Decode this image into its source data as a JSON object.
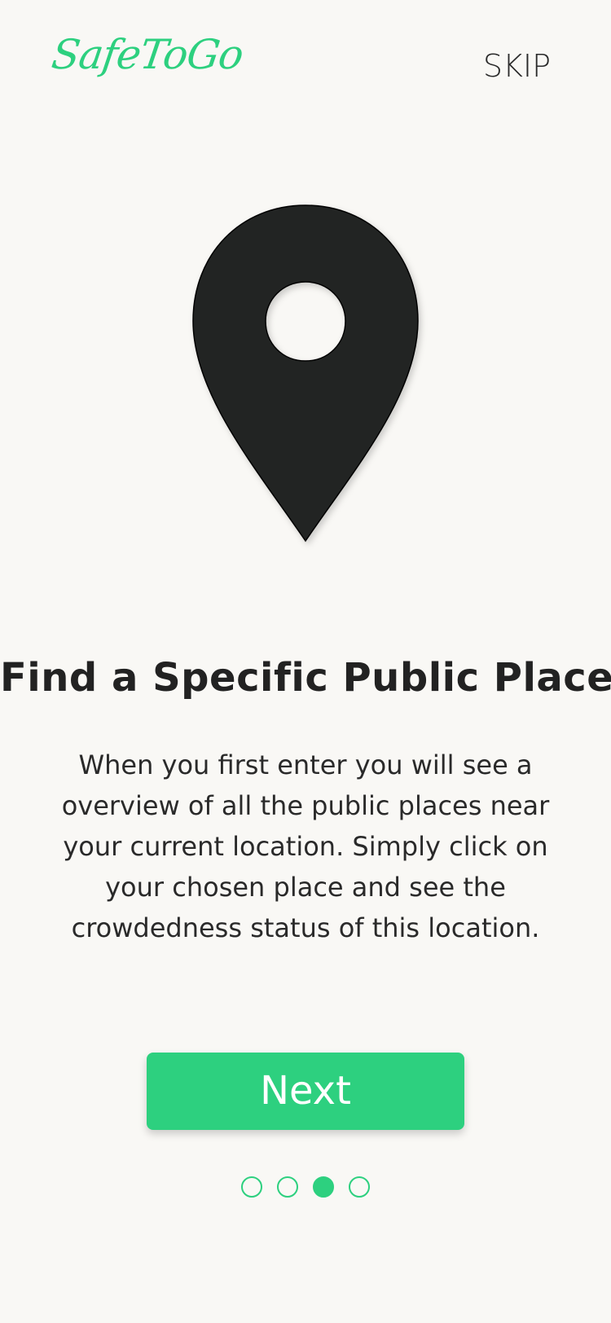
{
  "header": {
    "logo_text": "SafeToGo",
    "skip_label": "SKIP"
  },
  "illustration": {
    "icon": "location-pin-icon"
  },
  "content": {
    "title": "Find a Specific Public Place",
    "description": "When you first enter you will see a overview of all the public places near your current location. Simply click on your chosen place and see the crowdedness status of this location."
  },
  "actions": {
    "next_label": "Next"
  },
  "pagination": {
    "total": 4,
    "active_index": 2
  },
  "colors": {
    "accent": "#2dd07f",
    "background": "#f9f8f5",
    "text": "#222222"
  }
}
